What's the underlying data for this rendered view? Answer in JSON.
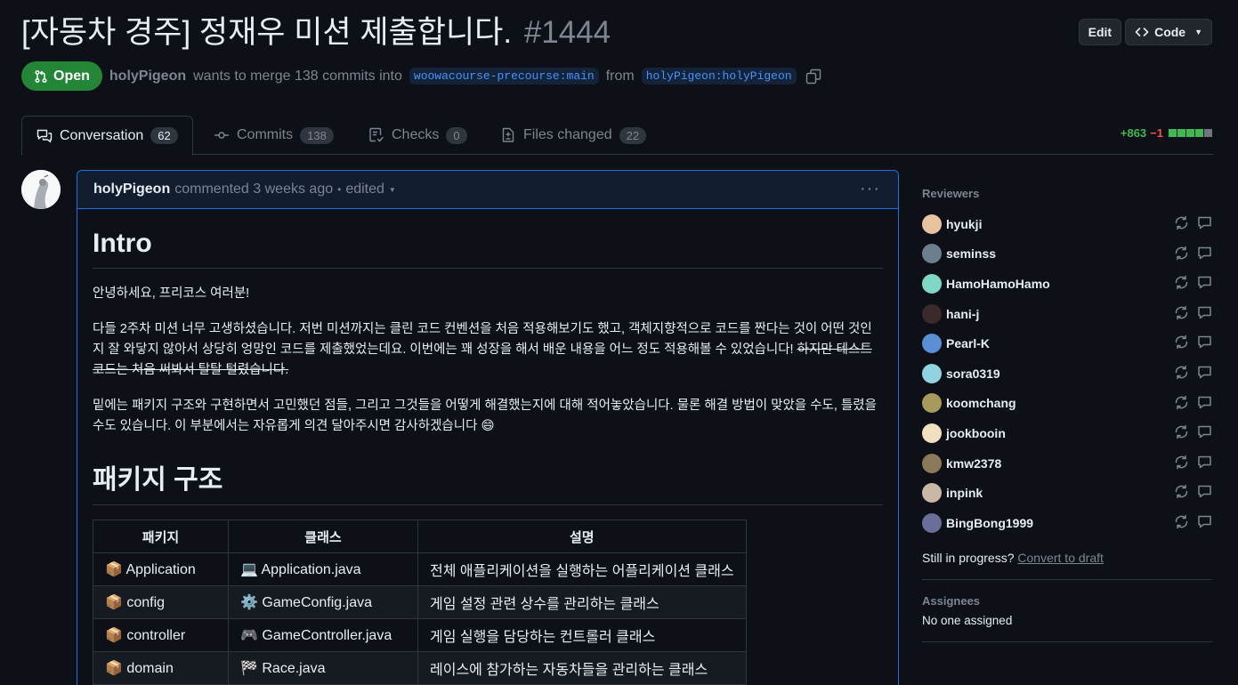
{
  "pr": {
    "title": "[자동차 경주] 정재우 미션 제출합니다.",
    "number": "#1444",
    "state": "Open",
    "author": "holyPigeon",
    "merge_text": "wants to merge 138 commits into",
    "base_branch": "woowacourse-precourse:main",
    "from_text": "from",
    "head_branch": "holyPigeon:holyPigeon"
  },
  "header": {
    "edit_label": "Edit",
    "code_label": "Code"
  },
  "tabs": [
    {
      "label": "Conversation",
      "count": "62"
    },
    {
      "label": "Commits",
      "count": "138"
    },
    {
      "label": "Checks",
      "count": "0"
    },
    {
      "label": "Files changed",
      "count": "22"
    }
  ],
  "diffstat": {
    "additions": "+863",
    "deletions": "−1"
  },
  "comment": {
    "author": "holyPigeon",
    "meta": "commented 3 weeks ago",
    "separator": "•",
    "edited": "edited",
    "h1": "Intro",
    "p1": "안녕하세요, 프리코스 여러분!",
    "p2a": "다들 2주차 미션 너무 고생하셨습니다. 저번 미션까지는 클린 코드 컨벤션을 처음 적용해보기도 했고, 객체지향적으로 코드를 짠다는 것이 어떤 것인지 잘 와닿지 않아서 상당히 엉망인 코드를 제출했었는데요. 이번에는 꽤 성장을 해서 배운 내용을 어느 정도 적용해볼 수 있었습니다! ",
    "p2b": "하지만 테스트 코드는 처음 써봐서 탈탈 털렸습니다.",
    "p3": "밑에는 패키지 구조와 구현하면서 고민했던 점들, 그리고 그것들을 어떻게 해결했는지에 대해 적어놓았습니다. 물론 해결 방법이 맞았을 수도, 틀렸을 수도 있습니다. 이 부분에서는 자유롭게 의견 달아주시면 감사하겠습니다 😄",
    "h2": "패키지 구조",
    "table": {
      "headers": [
        "패키지",
        "클래스",
        "설명"
      ],
      "rows": [
        {
          "pkg": "📦 Application",
          "cls": "💻 Application.java",
          "desc": "전체 애플리케이션을 실행하는 어플리케이션 클래스"
        },
        {
          "pkg": "📦 config",
          "cls": "⚙️ GameConfig.java",
          "desc": "게임 설정 관련 상수를 관리하는 클래스"
        },
        {
          "pkg": "📦 controller",
          "cls": "🎮 GameController.java",
          "desc": "게임 실행을 담당하는 컨트롤러 클래스"
        },
        {
          "pkg": "📦 domain",
          "cls": "🏁 Race.java",
          "desc": "레이스에 참가하는 자동차들을 관리하는 클래스"
        }
      ]
    }
  },
  "sidebar": {
    "reviewers_title": "Reviewers",
    "reviewers": [
      {
        "name": "hyukji",
        "color": "#e8c39e"
      },
      {
        "name": "seminss",
        "color": "#6b7f8e"
      },
      {
        "name": "HamoHamoHamo",
        "color": "#7fd8c4"
      },
      {
        "name": "hani-j",
        "color": "#3a2a2a"
      },
      {
        "name": "Pearl-K",
        "color": "#5a8fd6"
      },
      {
        "name": "sora0319",
        "color": "#8fd4e0"
      },
      {
        "name": "koomchang",
        "color": "#a89a5c"
      },
      {
        "name": "jookbooin",
        "color": "#f0e0c0"
      },
      {
        "name": "kmw2378",
        "color": "#8a7a5a"
      },
      {
        "name": "inpink",
        "color": "#c9b8a6"
      },
      {
        "name": "BingBong1999",
        "color": "#6a6e9a"
      }
    ],
    "draft_prompt": "Still in progress?",
    "draft_link": "Convert to draft",
    "assignees_title": "Assignees",
    "assignees_value": "No one assigned"
  }
}
